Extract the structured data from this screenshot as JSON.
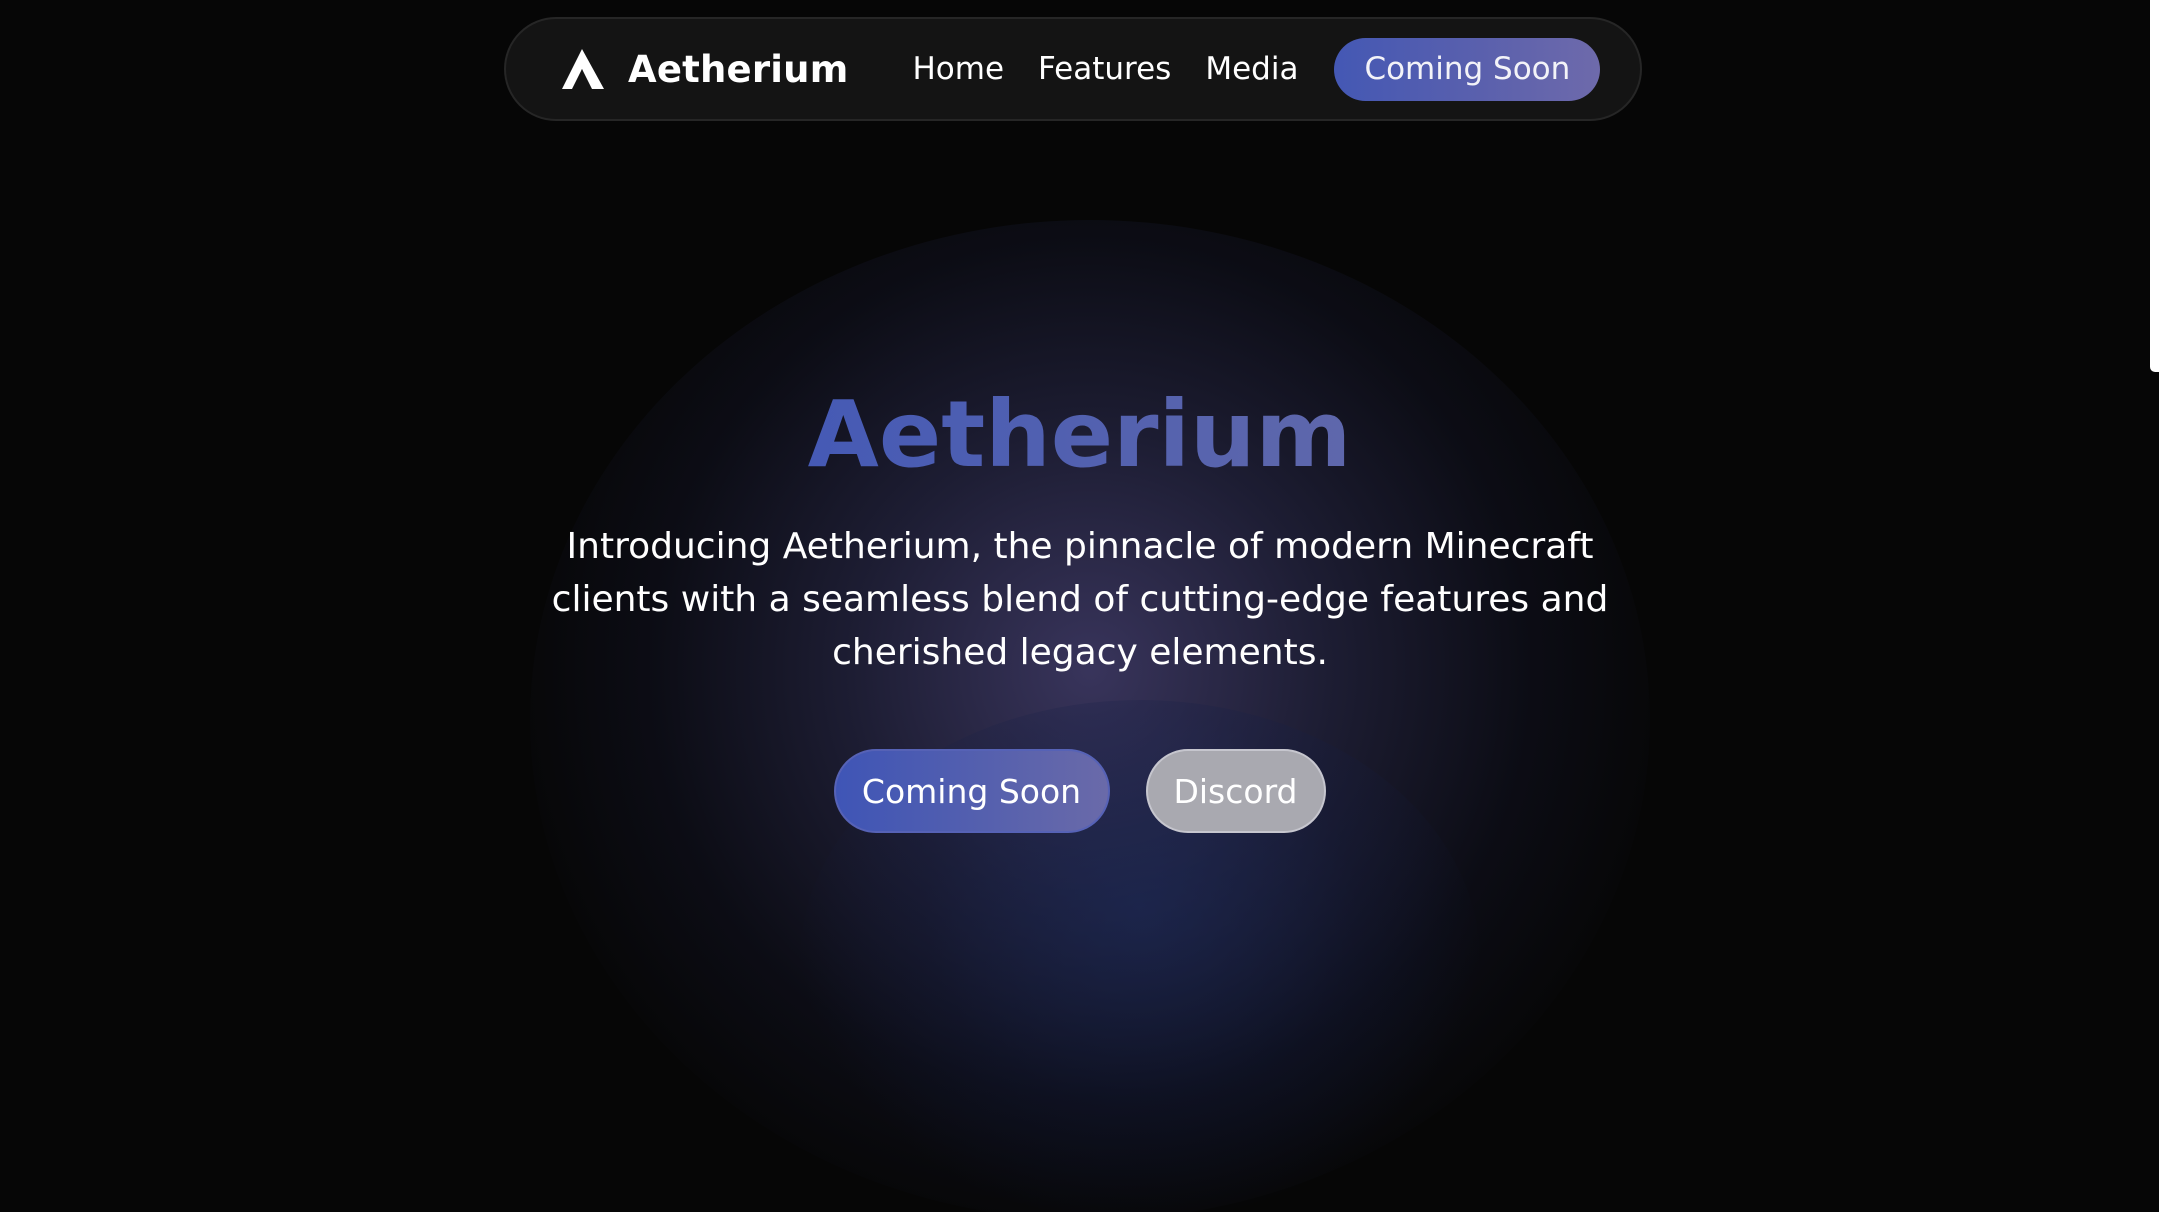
{
  "nav": {
    "brand_name": "Aetherium",
    "links": [
      "Home",
      "Features",
      "Media"
    ],
    "cta_label": "Coming Soon"
  },
  "hero": {
    "title": "Aetherium",
    "description": "Introducing Aetherium, the pinnacle of modern Minecraft clients with a seamless blend of cutting-edge features and cherished legacy elements.",
    "primary_button": "Coming Soon",
    "secondary_button": "Discord"
  },
  "colors": {
    "background": "#060606",
    "accent_start": "#3f55b6",
    "accent_end": "#6e6aab",
    "secondary_button": "#a9a9b0",
    "nav_background": "#141414"
  },
  "icons": {
    "brand_logo": "aetherium-logo-icon"
  }
}
